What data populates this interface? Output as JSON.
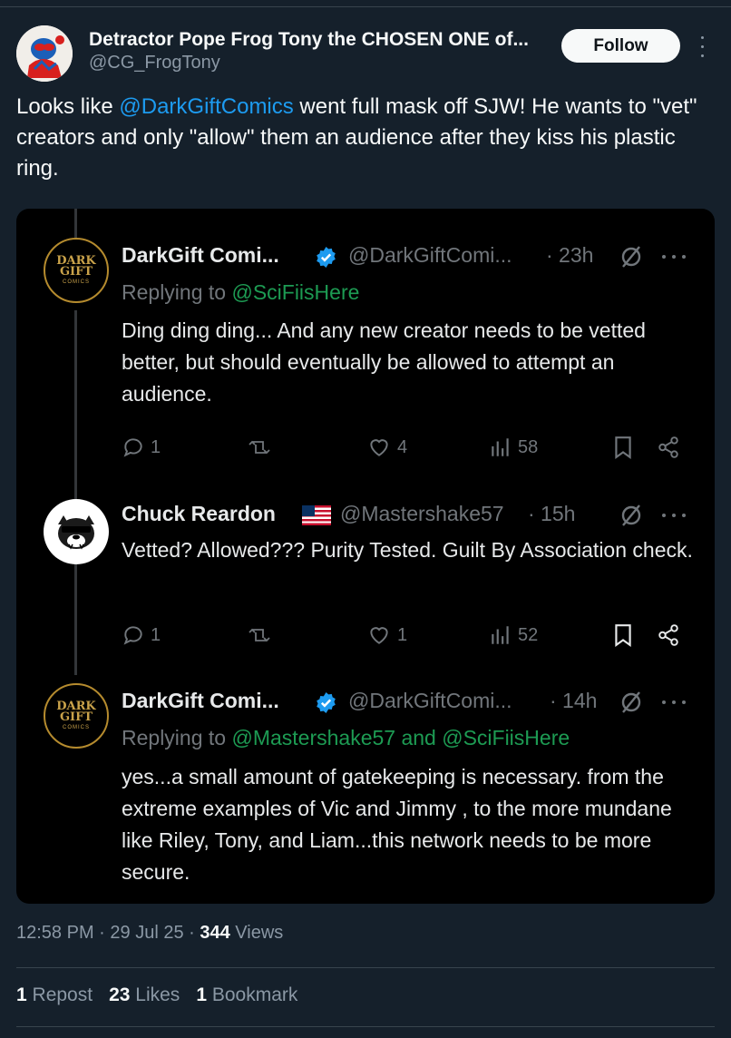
{
  "post": {
    "author_name": "Detractor Pope Frog Tony the CHOSEN ONE of...",
    "author_handle": "@CG_FrogTony",
    "follow_label": "Follow",
    "text_before": "Looks like ",
    "text_mention": "@DarkGiftComics",
    "text_after": " went full mask off SJW! He wants to \"vet\" creators and only \"allow\" them an audience after they kiss his plastic ring.",
    "time": "12:58 PM",
    "date": "29 Jul 25",
    "views_count": "344",
    "views_label": "Views",
    "reposts_count": "1",
    "reposts_label": "Repost",
    "likes_count": "23",
    "likes_label": "Likes",
    "bookmarks_count": "1",
    "bookmarks_label": "Bookmark"
  },
  "embed": {
    "replies": [
      {
        "avatar_text": [
          "DARK",
          "GIFT",
          "COMICS"
        ],
        "name": "DarkGift Comi...",
        "handle": "@DarkGiftComi...",
        "time": "· 23h",
        "replying_prefix": "Replying to ",
        "replying_to": "@SciFiisHere",
        "text": "Ding ding ding... And any new creator needs to be vetted better, but should eventually be allowed to attempt an audience.",
        "replies": "1",
        "reposts": "",
        "likes": "4",
        "views": "58"
      },
      {
        "name": "Chuck Reardon",
        "handle": "@Mastershake57",
        "time": "· 15h",
        "text": "Vetted? Allowed??? Purity Tested. Guilt By Association check.",
        "replies": "1",
        "reposts": "",
        "likes": "1",
        "views": "52"
      },
      {
        "avatar_text": [
          "DARK",
          "GIFT",
          "COMICS"
        ],
        "name": "DarkGift Comi...",
        "handle": "@DarkGiftComi...",
        "time": "· 14h",
        "replying_prefix": "Replying to ",
        "replying_to": "@Mastershake57 and @SciFiisHere",
        "text": "yes...a small amount of gatekeeping is necessary. from the extreme examples of Vic and Jimmy , to the more mundane like Riley, Tony, and Liam...this network needs to be more secure."
      }
    ]
  },
  "colors": {
    "background": "#15202b",
    "embed_background": "#000000",
    "link_blue": "#1d9bf0",
    "replying_green": "#1d9b53",
    "verified_blue": "#1d9bf0"
  }
}
